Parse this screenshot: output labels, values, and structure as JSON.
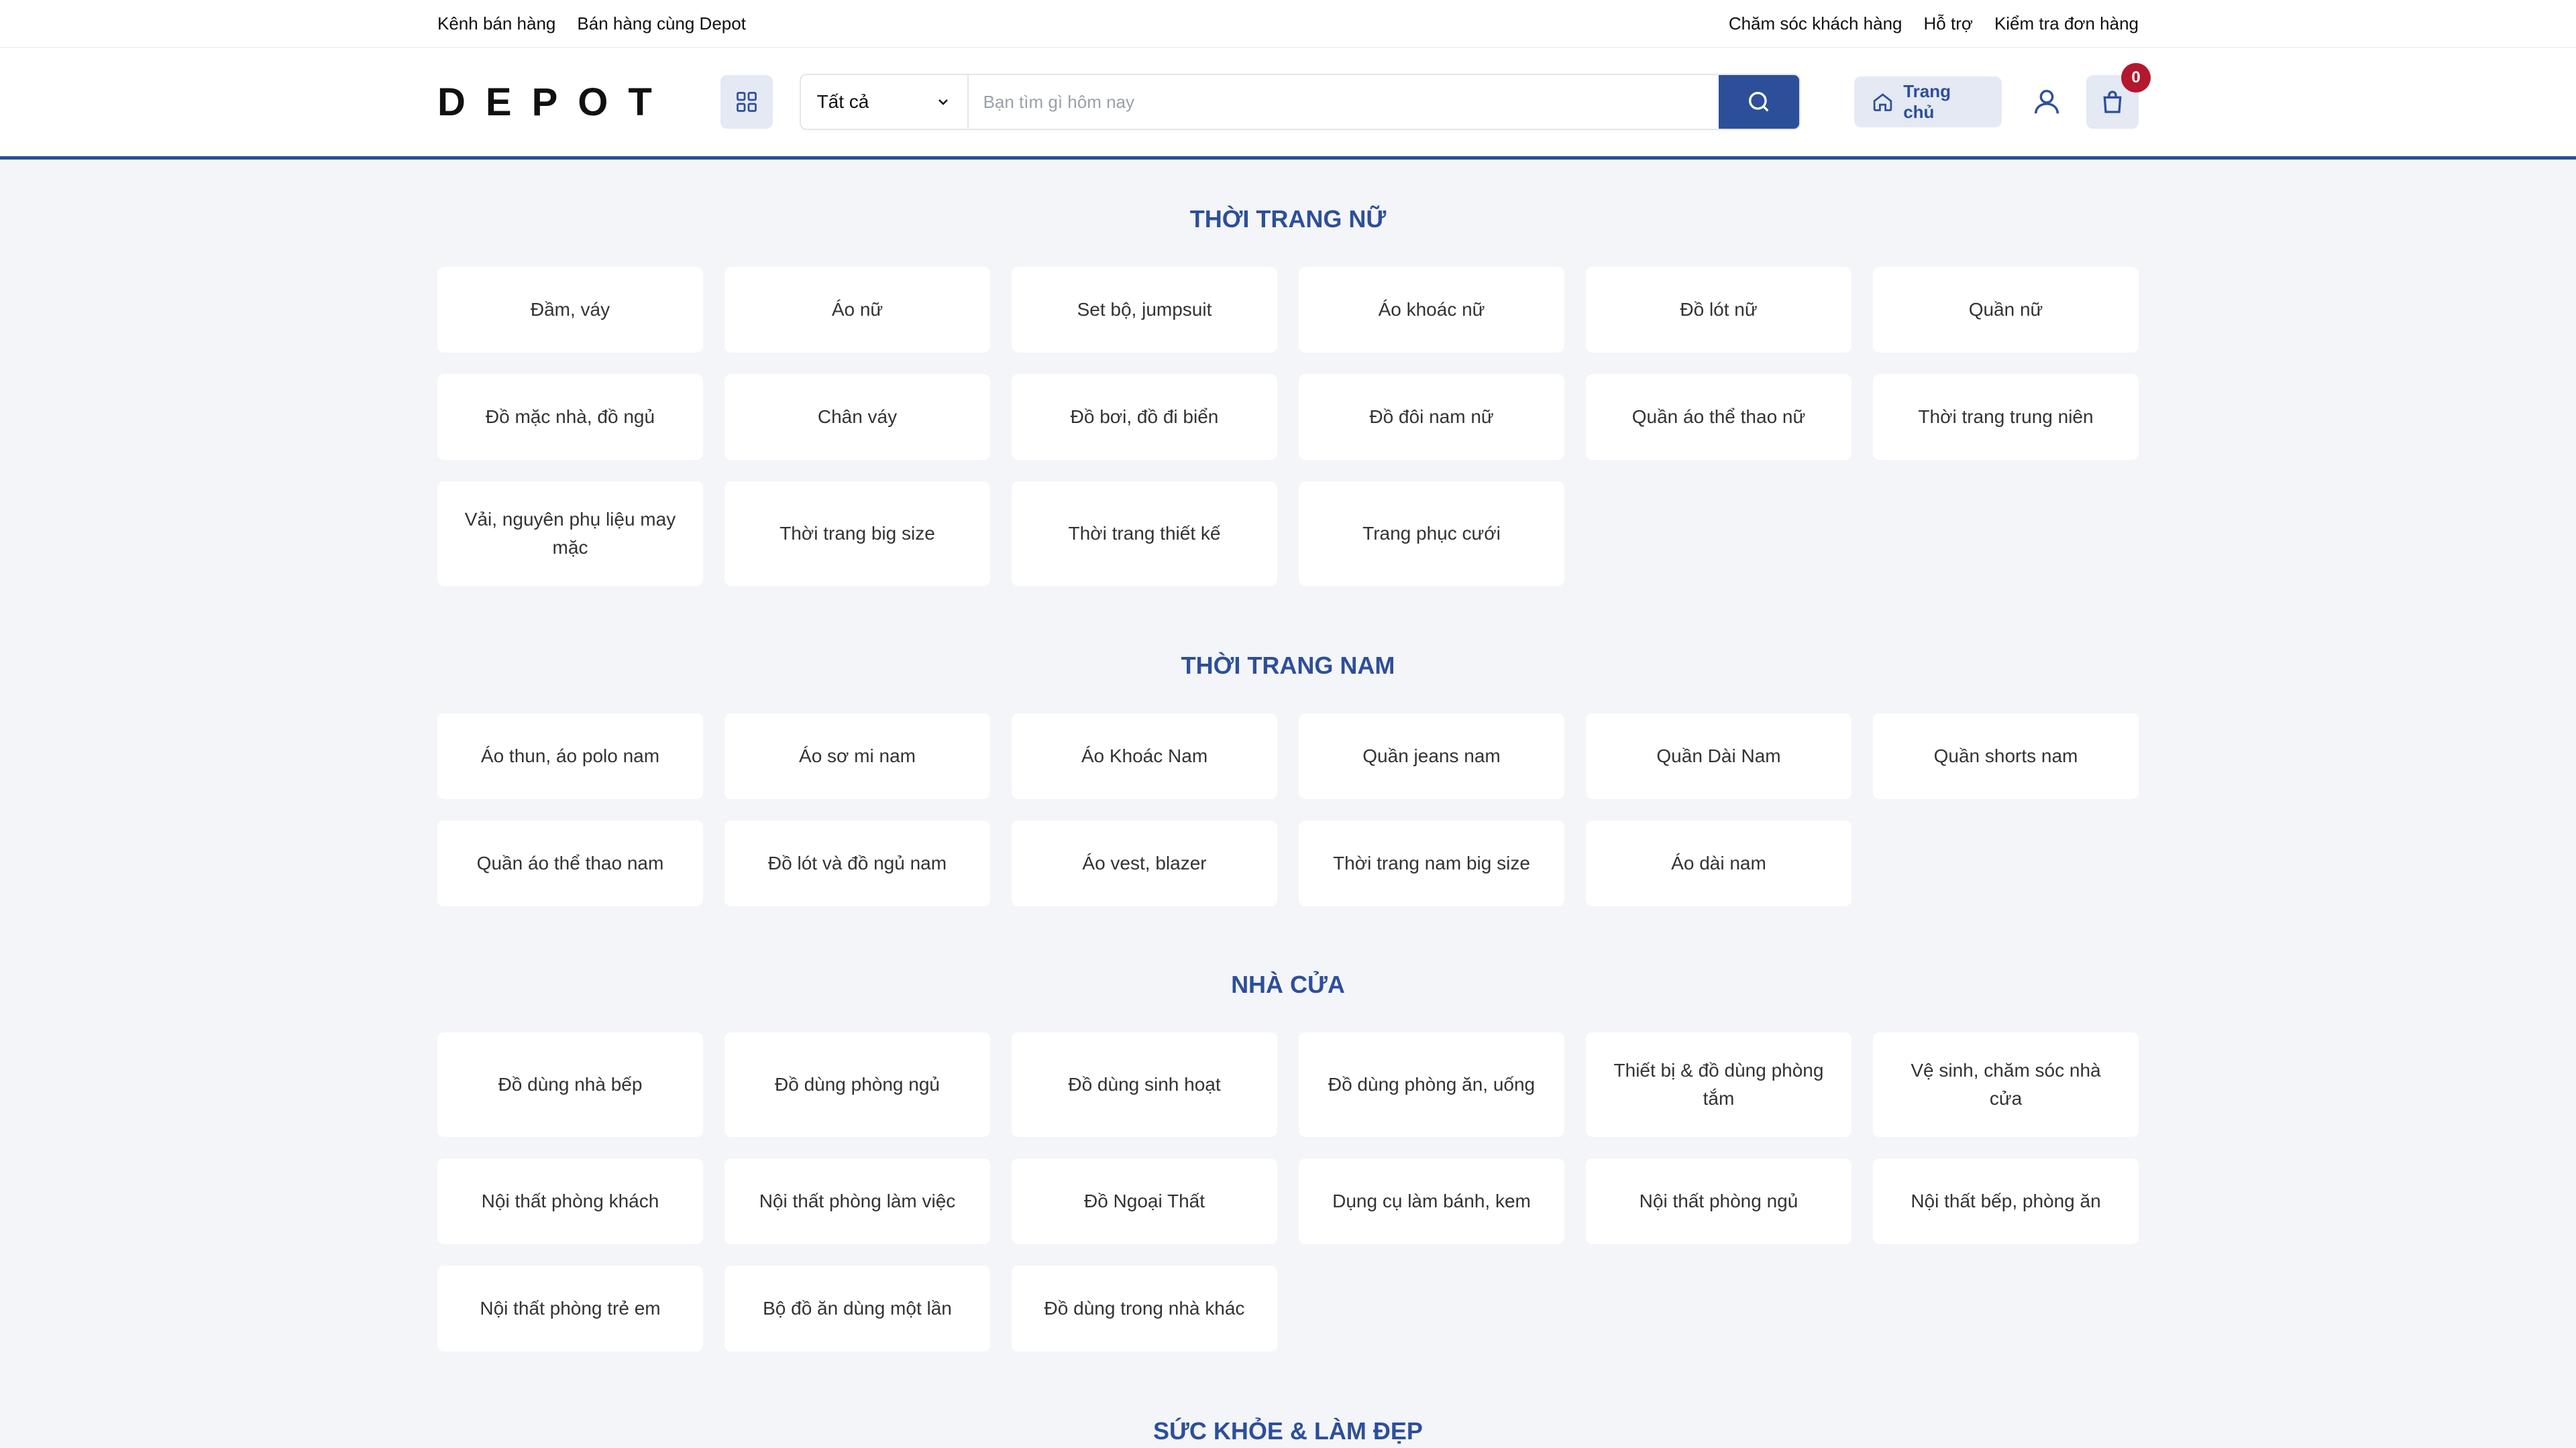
{
  "topbar": {
    "left_links": [
      "Kênh bán hàng",
      "Bán hàng cùng Depot"
    ],
    "right_links": [
      "Chăm sóc khách hàng",
      "Hỗ trợ",
      "Kiểm tra đơn hàng"
    ]
  },
  "header": {
    "logo": "DEPOT",
    "category_select": "Tất cả",
    "search_placeholder": "Bạn tìm gì hôm nay",
    "home_label": "Trang chủ",
    "cart_count": "0"
  },
  "sections": [
    {
      "title": "THỜI TRANG NỮ",
      "rows": [
        [
          "Đầm, váy",
          "Áo nữ",
          "Set bộ, jumpsuit",
          "Áo khoác nữ",
          "Đồ lót nữ",
          "Quần nữ"
        ],
        [
          "Đồ mặc nhà, đồ ngủ",
          "Chân váy",
          "Đồ bơi, đồ đi biển",
          "Đồ đôi nam nữ",
          "Quần áo thể thao nữ",
          "Thời trang trung niên"
        ],
        [
          "Vải, nguyên phụ liệu may mặc",
          "Thời trang big size",
          "Thời trang thiết kế",
          "Trang phục cưới"
        ]
      ]
    },
    {
      "title": "THỜI TRANG NAM",
      "rows": [
        [
          "Áo thun, áo polo nam",
          "Áo sơ mi nam",
          "Áo Khoác Nam",
          "Quần jeans nam",
          "Quần Dài Nam",
          "Quần shorts nam"
        ],
        [
          "Quần áo thể thao nam",
          "Đồ lót và đồ ngủ nam",
          "Áo vest, blazer",
          "Thời trang nam big size",
          "Áo dài nam"
        ]
      ]
    },
    {
      "title": "NHÀ CỬA",
      "rows": [
        [
          "Đồ dùng nhà bếp",
          "Đồ dùng phòng ngủ",
          "Đồ dùng sinh hoạt",
          "Đồ dùng phòng ăn, uống",
          "Thiết bị & đồ dùng phòng tắm",
          "Vệ sinh, chăm sóc nhà cửa"
        ],
        [
          "Nội thất phòng khách",
          "Nội thất phòng làm việc",
          "Đồ Ngoại Thất",
          "Dụng cụ làm bánh, kem",
          "Nội thất phòng ngủ",
          "Nội thất bếp, phòng ăn"
        ],
        [
          "Nội thất phòng trẻ em",
          "Bộ đồ ăn dùng một lần",
          "Đồ dùng trong nhà khác"
        ]
      ]
    },
    {
      "title": "SỨC KHỎE & LÀM ĐẸP",
      "rows": []
    }
  ]
}
